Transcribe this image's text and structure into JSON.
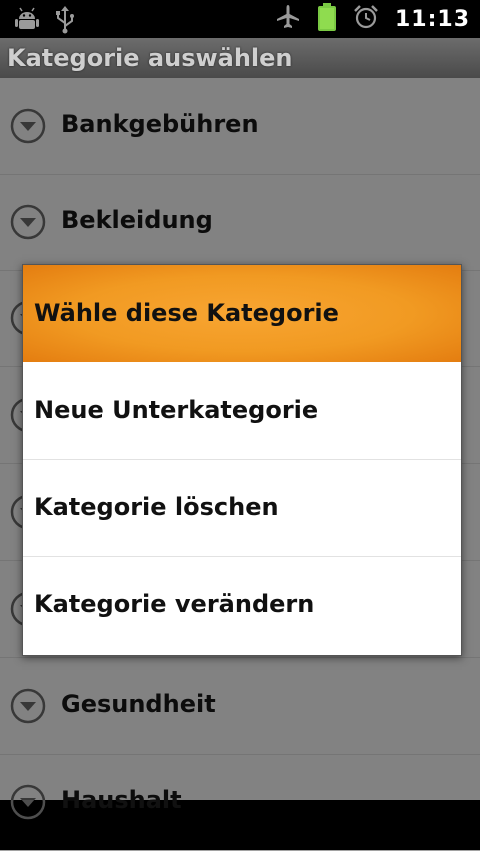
{
  "status_bar": {
    "time": "11:13",
    "left_icons": [
      "android-debug-icon",
      "usb-icon"
    ],
    "right_icons": [
      "airplane-mode-icon",
      "battery-icon",
      "alarm-icon"
    ]
  },
  "title": "Kategorie auswählen",
  "list": {
    "items": [
      {
        "label": "Bankgebühren"
      },
      {
        "label": "Bekleidung"
      },
      {
        "label": ""
      },
      {
        "label": ""
      },
      {
        "label": ""
      },
      {
        "label": ""
      },
      {
        "label": "Gesundheit"
      },
      {
        "label": "Haushalt"
      }
    ]
  },
  "menu": {
    "items": [
      {
        "label": "Wähle diese Kategorie",
        "selected": true
      },
      {
        "label": "Neue Unterkategorie"
      },
      {
        "label": "Kategorie löschen"
      },
      {
        "label": "Kategorie verändern"
      }
    ]
  },
  "colors": {
    "highlight": "#f39c1f",
    "list_background": "#b5b5b5",
    "title_bar": "#5a5a5a"
  }
}
